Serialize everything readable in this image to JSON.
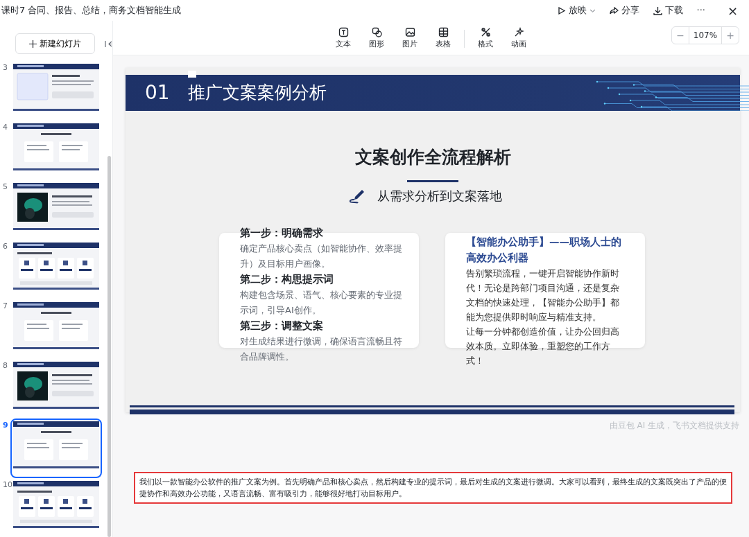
{
  "window": {
    "title": "课时7 合同、报告、总结，商务文档智能生成"
  },
  "top_actions": [
    {
      "kind": "play",
      "label": "放映"
    },
    {
      "kind": "share",
      "label": "分享"
    },
    {
      "kind": "download",
      "label": "下载"
    },
    {
      "kind": "more",
      "label": "···"
    },
    {
      "kind": "close",
      "label": "×"
    }
  ],
  "sidebar": {
    "new_slide_button": "新建幻灯片",
    "slides": [
      {
        "number": "3",
        "selected": false,
        "kind": "text"
      },
      {
        "number": "4",
        "selected": false,
        "kind": "columns"
      },
      {
        "number": "5",
        "selected": false,
        "kind": "brain"
      },
      {
        "number": "6",
        "selected": false,
        "kind": "cards"
      },
      {
        "number": "7",
        "selected": false,
        "kind": "columns"
      },
      {
        "number": "8",
        "selected": false,
        "kind": "brain"
      },
      {
        "number": "9",
        "selected": true,
        "kind": "columns"
      },
      {
        "number": "10",
        "selected": false,
        "kind": "cards"
      }
    ]
  },
  "toolbar": [
    {
      "kind": "text",
      "label": "文本"
    },
    {
      "kind": "shape",
      "label": "图形"
    },
    {
      "kind": "image",
      "label": "图片"
    },
    {
      "kind": "table",
      "label": "表格"
    },
    {
      "kind": "format",
      "label": "格式"
    },
    {
      "kind": "animation",
      "label": "动画"
    }
  ],
  "zoom": {
    "minus": "−",
    "value": "107%",
    "plus": "+"
  },
  "slide": {
    "number": "01",
    "title": "推广文案案例分析",
    "heading": "文案创作全流程解析",
    "subtitle": "从需求分析到文案落地",
    "steps": [
      {
        "title": "第一步：明确需求",
        "text": "确定产品核心卖点（如智能协作、效率提升）及目标用户画像。"
      },
      {
        "title": "第二步：构思提示词",
        "text": "构建包含场景、语气、核心要素的专业提示词，引导AI创作。"
      },
      {
        "title": "第三步：调整文案",
        "text": "对生成结果进行微调，确保语言流畅且符合品牌调性。"
      }
    ],
    "ad": {
      "title": "【智能办公助手】——职场人士的高效办公利器",
      "paragraphs": [
        "告别繁琐流程，一键开启智能协作新时代！无论是跨部门项目沟通，还是复杂文档的快速处理，【智能办公助手】都能为您提供即时响应与精准支持。",
        "让每一分钟都创造价值，让办公回归高效本质。立即体验，重塑您的工作方式！"
      ]
    }
  },
  "credit": "由豆包 AI 生成，飞书文档提供支持",
  "notes": "我们以一款智能办公软件的推广文案为例。首先明确产品和核心卖点，然后构建专业的提示词，最后对生成的文案进行微调。大家可以看到，最终生成的文案既突出了产品的便捷协作和高效办公功能，又语言流畅、富有吸引力，能够很好地打动目标用户。"
}
